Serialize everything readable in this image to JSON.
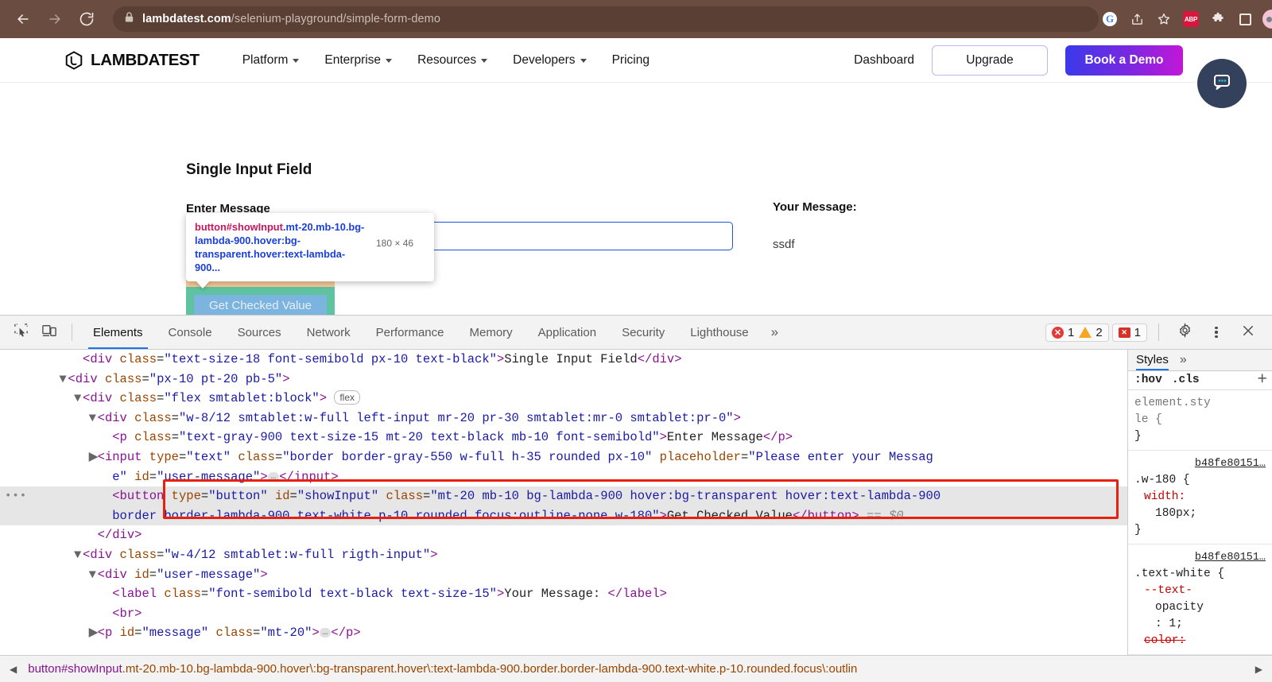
{
  "browser": {
    "url_bold": "lambdatest.com",
    "url_rest": "/selenium-playground/simple-form-demo",
    "back_icon": "back-arrow-icon",
    "forward_icon": "forward-arrow-icon",
    "reload_icon": "reload-icon",
    "lock_icon": "lock-icon",
    "extensions": [
      "google-icon",
      "share-icon",
      "bookmark-star-icon",
      "adblock-plus-icon",
      "puzzle-extensions-icon",
      "side-panel-icon",
      "profile-avatar-icon",
      "chrome-menu-icon"
    ],
    "abp_label": "ABP"
  },
  "site": {
    "logo_text": "LAMBDATEST",
    "nav": [
      {
        "label": "Platform",
        "has_caret": true
      },
      {
        "label": "Enterprise",
        "has_caret": true
      },
      {
        "label": "Resources",
        "has_caret": true
      },
      {
        "label": "Developers",
        "has_caret": true
      },
      {
        "label": "Pricing",
        "has_caret": false
      }
    ],
    "dashboard": "Dashboard",
    "upgrade": "Upgrade",
    "book_demo": "Book a Demo",
    "section_title": "Single Input Field",
    "enter_message_label": "Enter Message",
    "input_value": "",
    "input_placeholder": "",
    "button_label": "Get Checked Value",
    "your_message_label": "Your Message:",
    "message_value": "ssdf",
    "chat_icon": "chat-bubble-icon"
  },
  "inspect_tooltip": {
    "tag": "button#showInput",
    "classes": ".mt-20.mb-10.bg-lambda-900.hover:bg-transparent.hover:text-lambda-900...",
    "full_line1_tag": "button#showInput",
    "full_line1_cls": ".mt-20.mb-10.bg-l",
    "full_line2_cls": "ambda-900.hover:bg-transparent.ho",
    "full_line3_cls": "ver:text-lambda-900...",
    "dimensions": "180 × 46"
  },
  "devtools": {
    "inspect_icon": "inspect-element-icon",
    "device_icon": "device-toolbar-icon",
    "tabs": [
      "Elements",
      "Console",
      "Sources",
      "Network",
      "Performance",
      "Memory",
      "Application",
      "Security",
      "Lighthouse"
    ],
    "active_tab": "Elements",
    "more_tabs": "»",
    "errors": "1",
    "warnings": "2",
    "issues": "1",
    "settings_icon": "gear-icon",
    "menu_icon": "devtools-menu-icon",
    "close_icon": "close-icon",
    "dom_lines": [
      {
        "indent": 5,
        "twisty": "",
        "parts": [
          {
            "t": "punct",
            "v": "<"
          },
          {
            "t": "tag",
            "v": "div"
          },
          {
            "t": "plain",
            "v": " "
          },
          {
            "t": "attr",
            "v": "class"
          },
          {
            "t": "plain",
            "v": "="
          },
          {
            "t": "val",
            "v": "\"text-size-18 font-semibold px-10 text-black\""
          },
          {
            "t": "punct",
            "v": ">"
          },
          {
            "t": "txt",
            "v": "Single Input Field"
          },
          {
            "t": "punct",
            "v": "</"
          },
          {
            "t": "tag",
            "v": "div"
          },
          {
            "t": "punct",
            "v": ">"
          }
        ]
      },
      {
        "indent": 4,
        "twisty": "▼",
        "parts": [
          {
            "t": "punct",
            "v": "<"
          },
          {
            "t": "tag",
            "v": "div"
          },
          {
            "t": "plain",
            "v": " "
          },
          {
            "t": "attr",
            "v": "class"
          },
          {
            "t": "plain",
            "v": "="
          },
          {
            "t": "val",
            "v": "\"px-10 pt-20 pb-5\""
          },
          {
            "t": "punct",
            "v": ">"
          }
        ]
      },
      {
        "indent": 5,
        "twisty": "▼",
        "parts": [
          {
            "t": "punct",
            "v": "<"
          },
          {
            "t": "tag",
            "v": "div"
          },
          {
            "t": "plain",
            "v": " "
          },
          {
            "t": "attr",
            "v": "class"
          },
          {
            "t": "plain",
            "v": "="
          },
          {
            "t": "val",
            "v": "\"flex smtablet:block\""
          },
          {
            "t": "punct",
            "v": "> "
          },
          {
            "t": "badge",
            "v": "flex"
          }
        ]
      },
      {
        "indent": 6,
        "twisty": "▼",
        "parts": [
          {
            "t": "punct",
            "v": "<"
          },
          {
            "t": "tag",
            "v": "div"
          },
          {
            "t": "plain",
            "v": " "
          },
          {
            "t": "attr",
            "v": "class"
          },
          {
            "t": "plain",
            "v": "="
          },
          {
            "t": "val",
            "v": "\"w-8/12 smtablet:w-full left-input mr-20 pr-30 smtablet:mr-0 smtablet:pr-0\""
          },
          {
            "t": "punct",
            "v": ">"
          }
        ]
      },
      {
        "indent": 7,
        "twisty": "",
        "parts": [
          {
            "t": "punct",
            "v": "<"
          },
          {
            "t": "tag",
            "v": "p"
          },
          {
            "t": "plain",
            "v": " "
          },
          {
            "t": "attr",
            "v": "class"
          },
          {
            "t": "plain",
            "v": "="
          },
          {
            "t": "val",
            "v": "\"text-gray-900 text-size-15 mt-20 text-black mb-10 font-semibold\""
          },
          {
            "t": "punct",
            "v": ">"
          },
          {
            "t": "txt",
            "v": "Enter Message"
          },
          {
            "t": "punct",
            "v": "</"
          },
          {
            "t": "tag",
            "v": "p"
          },
          {
            "t": "punct",
            "v": ">"
          }
        ]
      },
      {
        "indent": 6,
        "twisty": "▶",
        "parts": [
          {
            "t": "punct",
            "v": "<"
          },
          {
            "t": "tag",
            "v": "input"
          },
          {
            "t": "plain",
            "v": " "
          },
          {
            "t": "attr",
            "v": "type"
          },
          {
            "t": "plain",
            "v": "="
          },
          {
            "t": "val",
            "v": "\"text\""
          },
          {
            "t": "plain",
            "v": " "
          },
          {
            "t": "attr",
            "v": "class"
          },
          {
            "t": "plain",
            "v": "="
          },
          {
            "t": "val",
            "v": "\"border border-gray-550 w-full h-35 rounded px-10\""
          },
          {
            "t": "plain",
            "v": " "
          },
          {
            "t": "attr",
            "v": "placeholder"
          },
          {
            "t": "plain",
            "v": "="
          },
          {
            "t": "val",
            "v": "\"Please enter your Messag"
          }
        ]
      },
      {
        "indent": 7,
        "twisty": "",
        "parts": [
          {
            "t": "val",
            "v": "e\""
          },
          {
            "t": "plain",
            "v": " "
          },
          {
            "t": "attr",
            "v": "id"
          },
          {
            "t": "plain",
            "v": "="
          },
          {
            "t": "val",
            "v": "\"user-message\""
          },
          {
            "t": "punct",
            "v": ">"
          },
          {
            "t": "dots",
            "v": "…"
          },
          {
            "t": "punct",
            "v": "</"
          },
          {
            "t": "tag",
            "v": "input"
          },
          {
            "t": "punct",
            "v": ">"
          }
        ]
      },
      {
        "indent": 7,
        "twisty": "",
        "selected": true,
        "parts": [
          {
            "t": "punct",
            "v": "<"
          },
          {
            "t": "tag",
            "v": "button"
          },
          {
            "t": "plain",
            "v": " "
          },
          {
            "t": "attr",
            "v": "type"
          },
          {
            "t": "plain",
            "v": "="
          },
          {
            "t": "val",
            "v": "\"button\""
          },
          {
            "t": "plain",
            "v": " "
          },
          {
            "t": "attr",
            "v": "id"
          },
          {
            "t": "plain",
            "v": "="
          },
          {
            "t": "val",
            "v": "\"showInput\""
          },
          {
            "t": "plain",
            "v": " "
          },
          {
            "t": "attr",
            "v": "class"
          },
          {
            "t": "plain",
            "v": "="
          },
          {
            "t": "val",
            "v": "\"mt-20 mb-10 bg-lambda-900 hover:bg-transparent hover:text-lambda-900"
          }
        ]
      },
      {
        "indent": 7,
        "twisty": "",
        "selected": true,
        "parts": [
          {
            "t": "val",
            "v": "border border-lambda-900 text-white p-10 rounded focus:outline-none w-180\""
          },
          {
            "t": "punct",
            "v": ">"
          },
          {
            "t": "txt",
            "v": "Get Checked Value"
          },
          {
            "t": "punct",
            "v": "</"
          },
          {
            "t": "tag",
            "v": "button"
          },
          {
            "t": "punct",
            "v": ">"
          },
          {
            "t": "plain",
            "v": " "
          },
          {
            "t": "eq",
            "v": "== $0"
          }
        ]
      },
      {
        "indent": 6,
        "twisty": "",
        "parts": [
          {
            "t": "punct",
            "v": "</"
          },
          {
            "t": "tag",
            "v": "div"
          },
          {
            "t": "punct",
            "v": ">"
          }
        ]
      },
      {
        "indent": 5,
        "twisty": "▼",
        "parts": [
          {
            "t": "punct",
            "v": "<"
          },
          {
            "t": "tag",
            "v": "div"
          },
          {
            "t": "plain",
            "v": " "
          },
          {
            "t": "attr",
            "v": "class"
          },
          {
            "t": "plain",
            "v": "="
          },
          {
            "t": "val",
            "v": "\"w-4/12 smtablet:w-full rigth-input\""
          },
          {
            "t": "punct",
            "v": ">"
          }
        ]
      },
      {
        "indent": 6,
        "twisty": "▼",
        "parts": [
          {
            "t": "punct",
            "v": "<"
          },
          {
            "t": "tag",
            "v": "div"
          },
          {
            "t": "plain",
            "v": " "
          },
          {
            "t": "attr",
            "v": "id"
          },
          {
            "t": "plain",
            "v": "="
          },
          {
            "t": "val",
            "v": "\"user-message\""
          },
          {
            "t": "punct",
            "v": ">"
          }
        ]
      },
      {
        "indent": 7,
        "twisty": "",
        "parts": [
          {
            "t": "punct",
            "v": "<"
          },
          {
            "t": "tag",
            "v": "label"
          },
          {
            "t": "plain",
            "v": " "
          },
          {
            "t": "attr",
            "v": "class"
          },
          {
            "t": "plain",
            "v": "="
          },
          {
            "t": "val",
            "v": "\"font-semibold text-black text-size-15\""
          },
          {
            "t": "punct",
            "v": ">"
          },
          {
            "t": "txt",
            "v": "Your Message: "
          },
          {
            "t": "punct",
            "v": "</"
          },
          {
            "t": "tag",
            "v": "label"
          },
          {
            "t": "punct",
            "v": ">"
          }
        ]
      },
      {
        "indent": 7,
        "twisty": "",
        "parts": [
          {
            "t": "punct",
            "v": "<"
          },
          {
            "t": "tag",
            "v": "br"
          },
          {
            "t": "punct",
            "v": ">"
          }
        ]
      },
      {
        "indent": 6,
        "twisty": "▶",
        "parts": [
          {
            "t": "punct",
            "v": "<"
          },
          {
            "t": "tag",
            "v": "p"
          },
          {
            "t": "plain",
            "v": " "
          },
          {
            "t": "attr",
            "v": "id"
          },
          {
            "t": "plain",
            "v": "="
          },
          {
            "t": "val",
            "v": "\"message\""
          },
          {
            "t": "plain",
            "v": " "
          },
          {
            "t": "attr",
            "v": "class"
          },
          {
            "t": "plain",
            "v": "="
          },
          {
            "t": "val",
            "v": "\"mt-20\""
          },
          {
            "t": "punct",
            "v": ">"
          },
          {
            "t": "dots",
            "v": "…"
          },
          {
            "t": "punct",
            "v": "</"
          },
          {
            "t": "tag",
            "v": "p"
          },
          {
            "t": "punct",
            "v": ">"
          }
        ]
      }
    ],
    "styles": {
      "tab": "Styles",
      "more": "»",
      "filter_hov": ":hov",
      "filter_cls": ".cls",
      "add_rule": "+",
      "rules": [
        {
          "source": "",
          "selector": "element.sty",
          "selector2": "le {",
          "close": "}",
          "props": []
        },
        {
          "source": "b48fe80151…",
          "selector": ".w-180 {",
          "close": "}",
          "props": [
            {
              "name": "width:",
              "value": "180px;",
              "strike": false
            }
          ]
        },
        {
          "source": "b48fe80151…",
          "selector": ".text-white {",
          "close": "}",
          "props": [
            {
              "name": "--text-",
              "value": "opacity",
              "value2": ": 1;",
              "strike": false
            },
            {
              "name": "color:",
              "value": "",
              "strike": true
            }
          ]
        }
      ]
    },
    "breadcrumb": {
      "tag": "button#showInput",
      "classes": ".mt-20.mb-10.bg-lambda-900.hover\\:bg-transparent.hover\\:text-lambda-900.border.border-lambda-900.text-white.p-10.rounded.focus\\:outlin",
      "left_arrow": "◀",
      "right_arrow": "▶"
    }
  }
}
